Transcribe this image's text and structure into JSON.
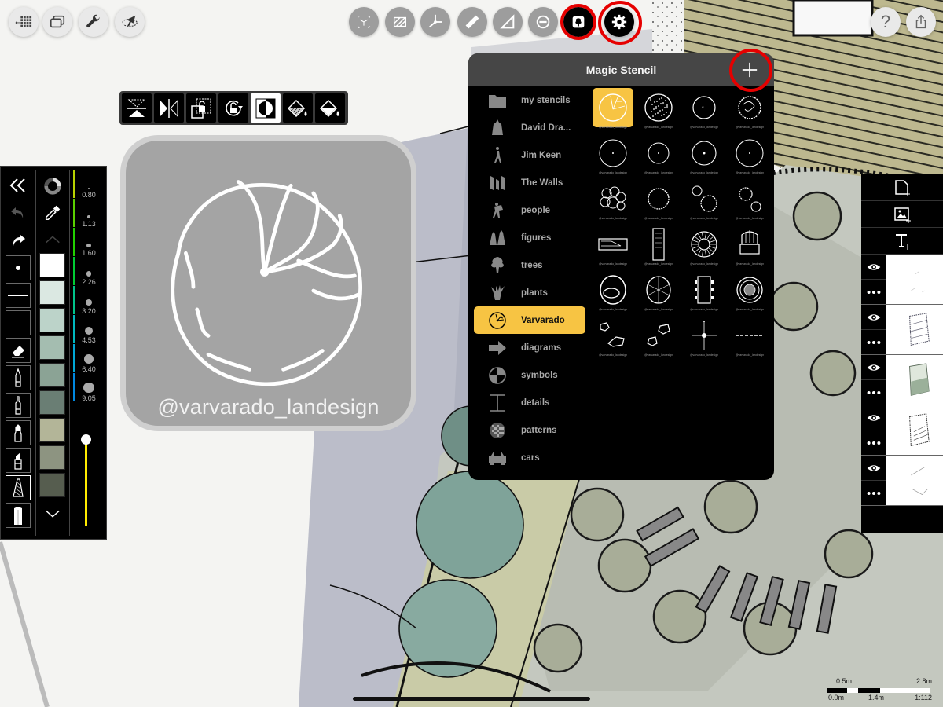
{
  "top_left_buttons": [
    {
      "id": "gallery",
      "icon": "grid-gallery-icon"
    },
    {
      "id": "layers-windows",
      "icon": "overlapping-windows-icon"
    },
    {
      "id": "settings-tools",
      "icon": "wrench-icon"
    },
    {
      "id": "selection",
      "icon": "lasso-arrow-icon"
    }
  ],
  "top_center_buttons": [
    {
      "id": "transform",
      "icon": "3d-transform-icon",
      "state": "disabled"
    },
    {
      "id": "hatch",
      "icon": "hatch-pattern-icon",
      "state": "disabled"
    },
    {
      "id": "perspective",
      "icon": "perspective-axes-icon",
      "state": "disabled"
    },
    {
      "id": "ruler",
      "icon": "ruler-icon",
      "state": "disabled"
    },
    {
      "id": "set-square",
      "icon": "triangle-ruler-icon",
      "state": "disabled"
    },
    {
      "id": "shape",
      "icon": "circle-minus-icon",
      "state": "disabled"
    },
    {
      "id": "magic-stencil",
      "icon": "tree-stencil-icon",
      "state": "active",
      "highlighted": true
    },
    {
      "id": "stencil-settings",
      "icon": "gear-icon",
      "state": "active",
      "highlighted": true
    }
  ],
  "top_right_buttons": [
    {
      "id": "help",
      "icon": "question-icon",
      "label": "?"
    },
    {
      "id": "share",
      "icon": "share-icon"
    }
  ],
  "stencil_toolbar": [
    {
      "id": "flip-vertical",
      "icon": "flip-vertical-icon"
    },
    {
      "id": "flip-horizontal",
      "icon": "flip-horizontal-icon"
    },
    {
      "id": "unlock-scale",
      "icon": "unlock-scale-icon"
    },
    {
      "id": "unlock-rotate",
      "icon": "unlock-rotate-icon"
    },
    {
      "id": "invert",
      "icon": "invert-contrast-icon"
    },
    {
      "id": "fill-pattern",
      "icon": "hatch-fill-icon"
    },
    {
      "id": "fill-solid",
      "icon": "solid-fill-icon"
    }
  ],
  "stencil_preview": {
    "credit": "@varvarado_landesign"
  },
  "left_palette": {
    "tools": [
      {
        "id": "collapse",
        "icon": "double-chevron-left-icon"
      },
      {
        "id": "undo",
        "icon": "undo-icon",
        "state": "disabled"
      },
      {
        "id": "redo",
        "icon": "redo-icon"
      },
      {
        "id": "dot-brush",
        "icon": "dot-icon"
      },
      {
        "id": "line-brush",
        "icon": "line-icon"
      },
      {
        "id": "blank-brush",
        "icon": "blank-icon"
      },
      {
        "id": "eraser",
        "icon": "eraser-icon"
      },
      {
        "id": "fine-pen",
        "icon": "fine-pen-icon"
      },
      {
        "id": "technical-pen",
        "icon": "technical-pen-icon"
      },
      {
        "id": "marker",
        "icon": "marker-icon"
      },
      {
        "id": "chisel-marker",
        "icon": "chisel-marker-icon"
      },
      {
        "id": "texture-brush",
        "icon": "texture-brush-icon",
        "active": true
      },
      {
        "id": "pencil",
        "icon": "pencil-icon"
      }
    ],
    "color_tools": [
      {
        "id": "color-wheel",
        "icon": "color-wheel-icon"
      },
      {
        "id": "eyedropper",
        "icon": "eyedropper-icon"
      },
      {
        "id": "scroll-up",
        "icon": "chevron-up-icon"
      },
      {
        "id": "scroll-down",
        "icon": "chevron-down-icon"
      }
    ],
    "swatches": [
      "#ffffff",
      "#dbe8e2",
      "#bcd3c9",
      "#a4bdb0",
      "#8ba395",
      "#6a7e74",
      "#b3b598",
      "#8d9481",
      "#565d4f"
    ],
    "sizes": [
      {
        "value": "0.80",
        "color": "#b7d300"
      },
      {
        "value": "1.13",
        "color": "#5ad000"
      },
      {
        "value": "1.60",
        "color": "#22d000"
      },
      {
        "value": "2.26",
        "color": "#00cc33"
      },
      {
        "value": "3.20",
        "color": "#00c48a"
      },
      {
        "value": "4.53",
        "color": "#00b9bf"
      },
      {
        "value": "6.40",
        "color": "#00a8d6"
      },
      {
        "value": "9.05",
        "color": "#0088e0"
      }
    ],
    "opacity": 1.0,
    "opacity_color": "#ffeb00"
  },
  "magic_stencil": {
    "title": "Magic Stencil",
    "add_icon": "plus-icon",
    "categories": [
      {
        "label": "my stencils",
        "icon": "folder-icon"
      },
      {
        "label": "David Dra...",
        "icon": "figure-cloak-icon"
      },
      {
        "label": "Jim Keen",
        "icon": "figure-walking-icon"
      },
      {
        "label": "The Walls",
        "icon": "walls-icon"
      },
      {
        "label": "people",
        "icon": "people-icon"
      },
      {
        "label": "figures",
        "icon": "figures-icon"
      },
      {
        "label": "trees",
        "icon": "tree-icon"
      },
      {
        "label": "plants",
        "icon": "plant-icon"
      },
      {
        "label": "Varvarado",
        "icon": "tree-plan-icon",
        "selected": true
      },
      {
        "label": "diagrams",
        "icon": "arrow-right-icon"
      },
      {
        "label": "symbols",
        "icon": "section-marker-icon"
      },
      {
        "label": "details",
        "icon": "i-beam-icon"
      },
      {
        "label": "patterns",
        "icon": "checker-pattern-icon"
      },
      {
        "label": "cars",
        "icon": "car-icon"
      }
    ],
    "stencils": [
      {
        "name": "tree-canopy-veined",
        "caption": "@varvarado_landesign",
        "selected": true
      },
      {
        "name": "tree-canopy-dotted",
        "caption": "@varvarado_landesign"
      },
      {
        "name": "tree-canopy-small",
        "caption": "@varvarado_landesign"
      },
      {
        "name": "tree-canopy-spiky",
        "caption": "@varvarado_landesign"
      },
      {
        "name": "tree-outline-1",
        "caption": "@varvarado_landesign"
      },
      {
        "name": "tree-outline-2",
        "caption": "@varvarado_landesign"
      },
      {
        "name": "tree-outline-3",
        "caption": "@varvarado_landesign"
      },
      {
        "name": "tree-outline-4",
        "caption": "@varvarado_landesign"
      },
      {
        "name": "shrub-cluster",
        "caption": "@varvarado_landesign"
      },
      {
        "name": "shrub-round",
        "caption": "@varvarado_landesign"
      },
      {
        "name": "shrub-pair-1",
        "caption": "@varvarado_landesign"
      },
      {
        "name": "shrub-pair-2",
        "caption": "@varvarado_landesign"
      },
      {
        "name": "bench",
        "caption": "@varvarado_landesign"
      },
      {
        "name": "lounger",
        "caption": "@varvarado_landesign"
      },
      {
        "name": "fire-pit",
        "caption": "@varvarado_landesign"
      },
      {
        "name": "adirondack-chair",
        "caption": "@varvarado_landesign"
      },
      {
        "name": "hot-tub",
        "caption": "@varvarado_landesign"
      },
      {
        "name": "fountain",
        "caption": "@varvarado_landesign"
      },
      {
        "name": "dining-table",
        "caption": "@varvarado_landesign"
      },
      {
        "name": "round-planter",
        "caption": "@varvarado_landesign"
      },
      {
        "name": "boulders-1",
        "caption": "@varvarado_landesign"
      },
      {
        "name": "boulders-2",
        "caption": "@varvarado_landesign"
      },
      {
        "name": "light-star",
        "caption": "@varvarado_landesign"
      },
      {
        "name": "dashed-line",
        "caption": "@varvarado_landesign"
      }
    ]
  },
  "layers_panel": {
    "actions": [
      {
        "id": "add-layer",
        "icon": "add-page-icon"
      },
      {
        "id": "add-image",
        "icon": "add-image-icon"
      },
      {
        "id": "add-text",
        "icon": "add-text-icon"
      }
    ],
    "layers": [
      {
        "id": "layer-1",
        "visible": true,
        "thumb": "sketch-light"
      },
      {
        "id": "layer-2",
        "visible": true,
        "thumb": "plan-outline-blue"
      },
      {
        "id": "layer-3",
        "visible": true,
        "thumb": "plan-colored"
      },
      {
        "id": "layer-4",
        "visible": true,
        "thumb": "plan-outline-dark"
      },
      {
        "id": "layer-5",
        "visible": true,
        "thumb": "sketch-faint"
      }
    ]
  },
  "scale_bar": {
    "top_left": "0.5m",
    "top_right": "2.8m",
    "bottom_left": "0.0m",
    "bottom_mid": "1.4m",
    "ratio": "1:112"
  },
  "colors": {
    "highlight_ring": "#e60000",
    "selected_accent": "#f7c443",
    "panel_header": "#464646"
  }
}
